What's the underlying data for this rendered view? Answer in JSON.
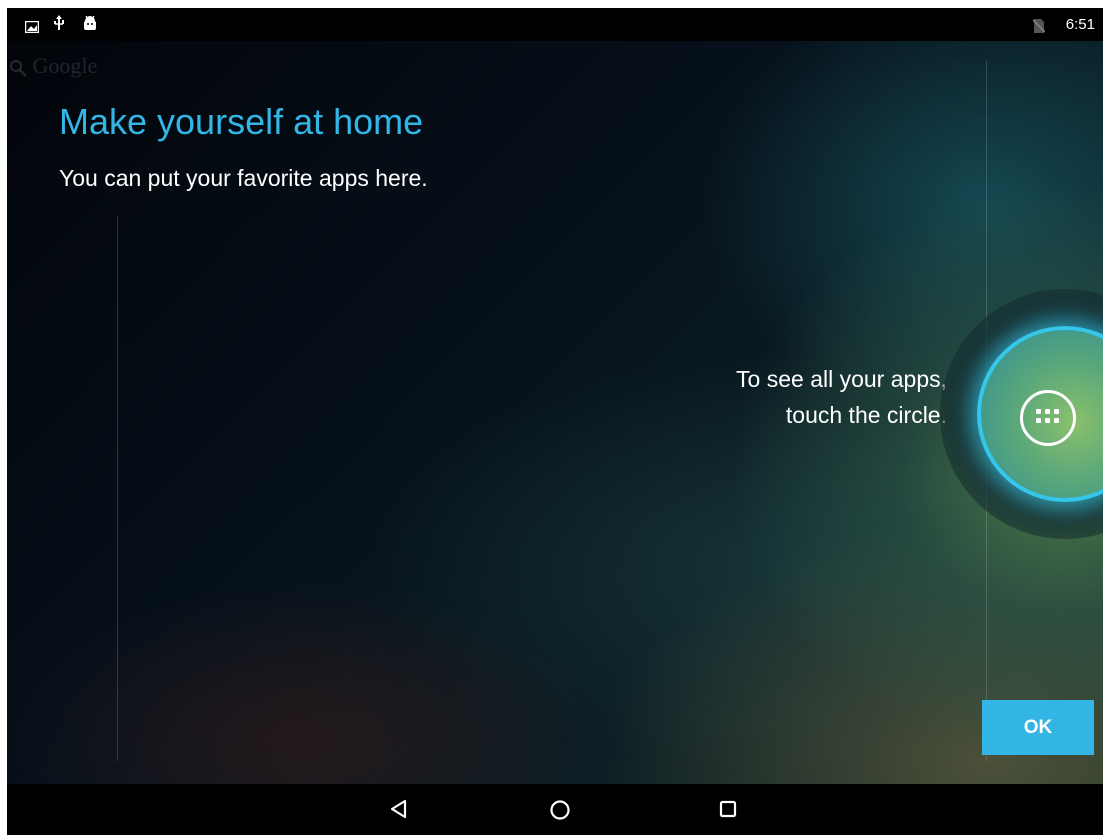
{
  "status_bar": {
    "time": "6:51",
    "left_icons": [
      "gallery-icon",
      "usb-icon",
      "android-debug-icon"
    ],
    "right_icons": [
      "no-sim-icon"
    ]
  },
  "home": {
    "ghost_search_text": "Google",
    "title": "Make yourself at home",
    "subtitle": "You can put your favorite apps here.",
    "hint": "To see all your apps, touch the circle.",
    "all_apps_icon": "all-apps-icon",
    "ok_label": "OK",
    "accent_color": "#33b5e5"
  },
  "nav_bar": {
    "buttons": [
      "back-icon",
      "home-icon",
      "recents-icon"
    ]
  }
}
